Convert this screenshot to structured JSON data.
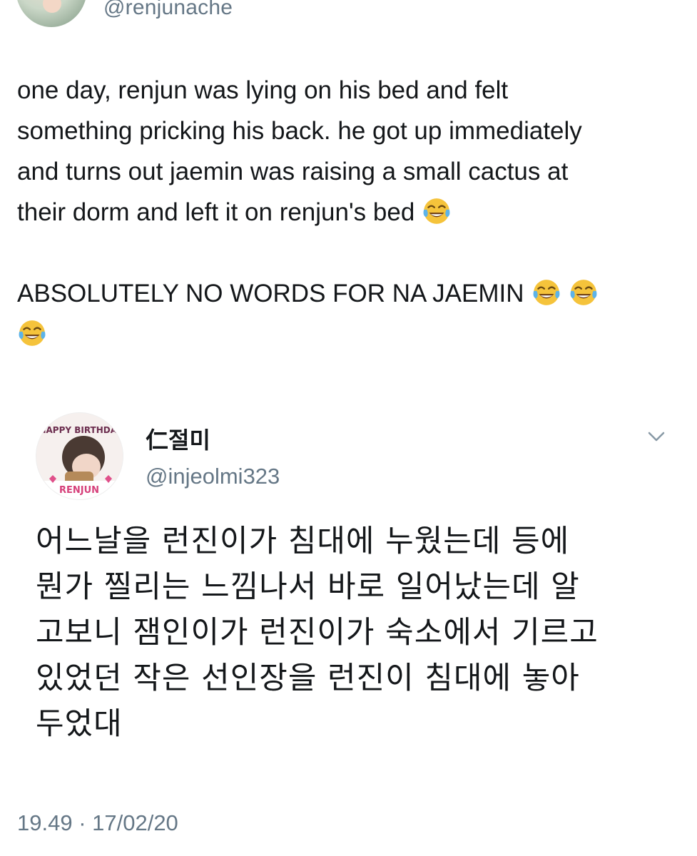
{
  "author": {
    "handle": "@renjunache"
  },
  "tweet": {
    "lines": [
      "one day, renjun was lying on his bed and felt",
      "something pricking his back. he got up immediately",
      "and turns out jaemin was raising a small cactus at",
      "their dorm and left it on renjun's bed"
    ],
    "second_paragraph": "ABSOLUTELY NO WORDS FOR NA JAEMIN",
    "emoji_icon": "face-with-tears-of-joy"
  },
  "quoted": {
    "name": "仁절미",
    "handle": "@injeolmi323",
    "avatar_text_top": "HAPPY BIRTHDAY",
    "avatar_text_bottom": "RENJUN",
    "lines": [
      "어느날을 런진이가 침대에 누웠는데 등에",
      "뭔가 찔리는 느낌나서 바로 일어났는데 알",
      "고보니 잼인이가 런진이가 숙소에서 기르고",
      "있었던 작은 선인장을 런진이 침대에 놓아",
      "두었대"
    ]
  },
  "timestamp": "19.49 · 17/02/20",
  "colors": {
    "text": "#14171a",
    "secondary": "#657786",
    "emoji_face": "#f5c33b",
    "emoji_tears": "#5db3e8"
  }
}
